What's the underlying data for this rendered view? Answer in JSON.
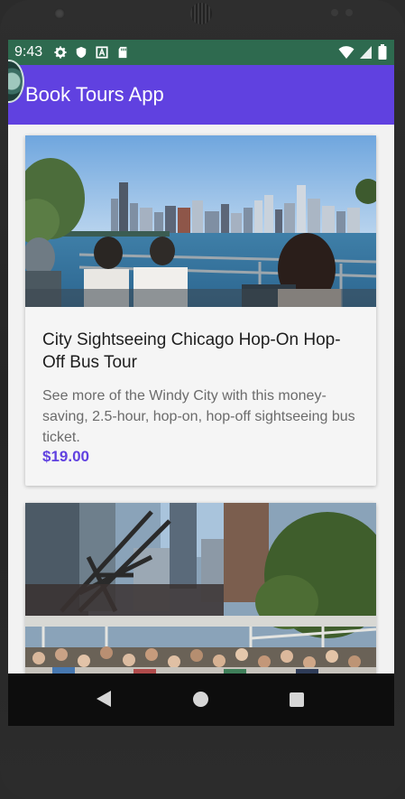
{
  "status_bar": {
    "time": "9:43",
    "left_icons": [
      "gear-icon",
      "shield-icon",
      "font-a-icon",
      "sd-card-icon"
    ],
    "right_icons": [
      "wifi-icon",
      "signal-icon",
      "battery-icon"
    ]
  },
  "app_bar": {
    "title": "Book Tours App"
  },
  "tours": [
    {
      "title": "City Sightseeing Chicago Hop-On Hop-Off Bus Tour",
      "description": "See more of the Windy City with this money-saving, 2.5-hour, hop-on, hop-off sightseeing bus ticket.",
      "price": "$19.00",
      "image": "chicago-skyline-bus-photo"
    },
    {
      "title": "",
      "description": "",
      "price": "",
      "image": "chicago-river-boat-photo"
    }
  ],
  "nav_bar": {
    "icons": [
      "back-icon",
      "home-icon",
      "recents-icon"
    ]
  },
  "colors": {
    "status_bar": "#2e6a4f",
    "app_bar": "#6041e0",
    "price": "#6041e0",
    "background": "#f2f2f2"
  }
}
